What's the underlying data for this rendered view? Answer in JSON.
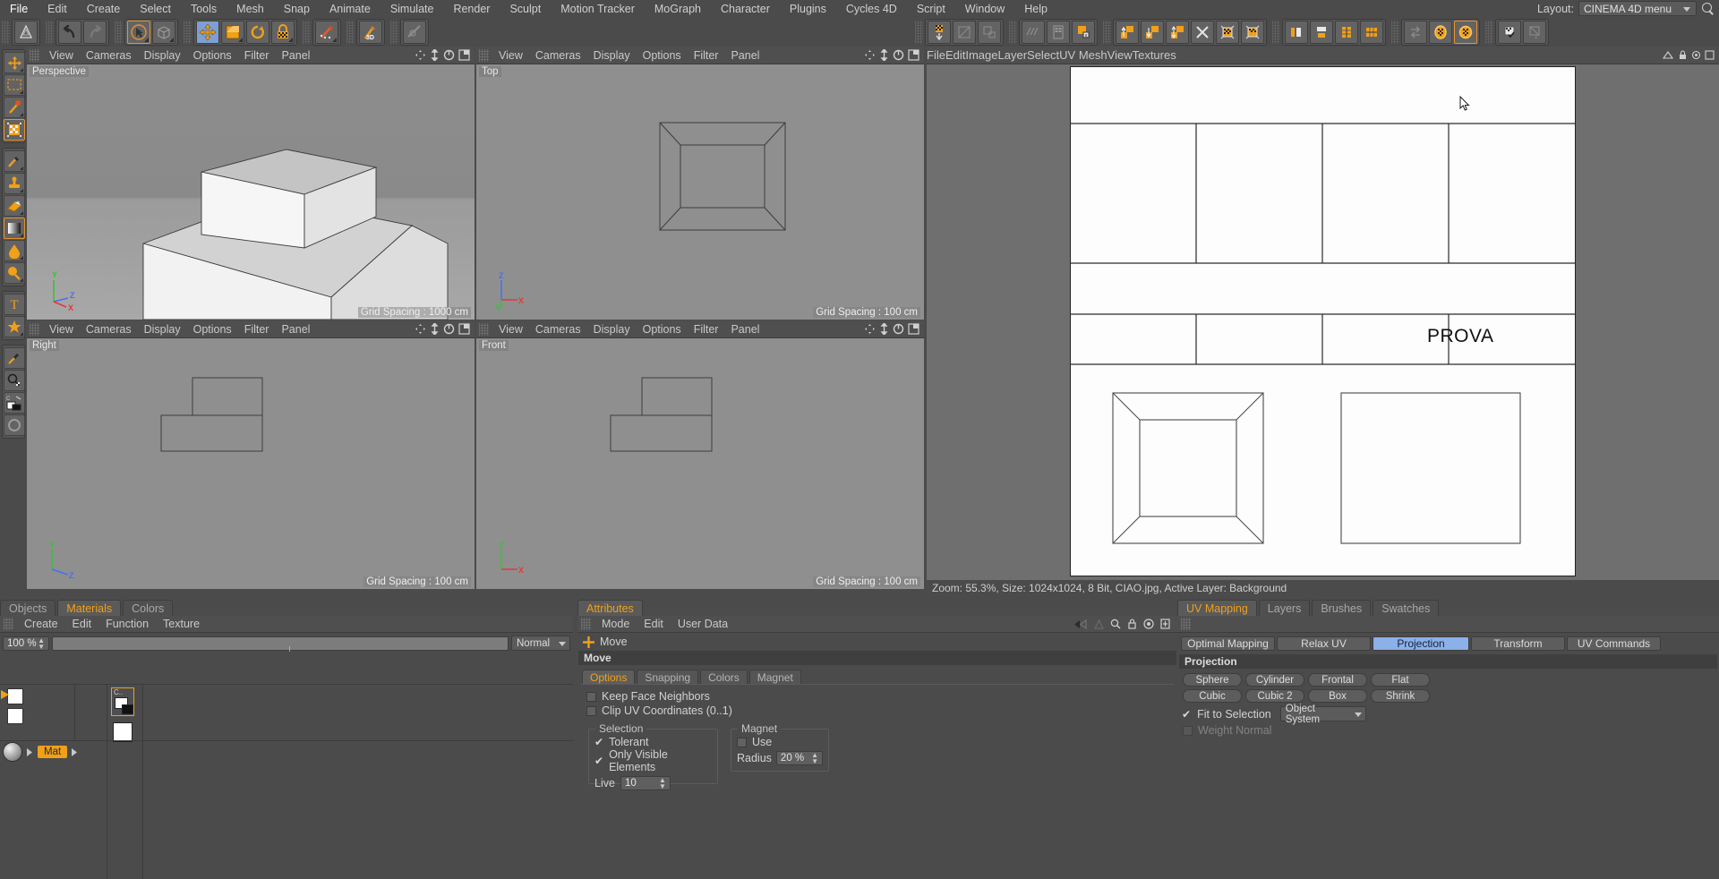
{
  "menubar": {
    "items": [
      "File",
      "Edit",
      "Create",
      "Select",
      "Tools",
      "Mesh",
      "Snap",
      "Animate",
      "Simulate",
      "Render",
      "Sculpt",
      "Motion Tracker",
      "MoGraph",
      "Character",
      "Plugins",
      "Cycles 4D",
      "Script",
      "Window",
      "Help"
    ],
    "layout_label": "Layout:",
    "layout_value": "CINEMA 4D menu",
    "search_icon": "search-icon"
  },
  "viewports": {
    "menu_items": [
      "View",
      "Cameras",
      "Display",
      "Options",
      "Filter",
      "Panel"
    ],
    "perspective": {
      "label": "Perspective",
      "grid": "Grid Spacing : 1000 cm"
    },
    "top": {
      "label": "Top",
      "grid": "Grid Spacing : 100 cm"
    },
    "right": {
      "label": "Right",
      "grid": "Grid Spacing : 100 cm"
    },
    "front": {
      "label": "Front",
      "grid": "Grid Spacing : 100 cm"
    },
    "axis_labels": [
      "X",
      "Y",
      "Z"
    ],
    "axis_colors": {
      "x": "#e03a3a",
      "y": "#35c435",
      "z": "#4a6ff0"
    }
  },
  "uv_editor": {
    "menu_items": [
      "File",
      "Edit",
      "Image",
      "Layer",
      "Select",
      "UV Mesh",
      "View",
      "Textures"
    ],
    "canvas_text": "PROVA",
    "status": "Zoom: 55.3%, Size: 1024x1024, 8 Bit, CIAO.jpg, Active Layer: Background"
  },
  "materials_panel": {
    "tabs": [
      {
        "label": "Objects",
        "active": false
      },
      {
        "label": "Materials",
        "active": true
      },
      {
        "label": "Colors",
        "active": false
      }
    ],
    "menu_items": [
      "Create",
      "Edit",
      "Function",
      "Texture"
    ],
    "zoom_value": "100 %",
    "blend_mode": "Normal",
    "material_name": "Mat",
    "swatch_label": "C.."
  },
  "attributes_panel": {
    "tabs": [
      {
        "label": "Attributes",
        "active": true
      }
    ],
    "menu_items": [
      "Mode",
      "Edit",
      "User Data"
    ],
    "breadcrumb": "Move",
    "section_title": "Move",
    "tool_icon": "move-plus-icon",
    "tabs_inner": [
      {
        "label": "Options",
        "active": true
      },
      {
        "label": "Snapping",
        "active": false
      },
      {
        "label": "Colors",
        "active": false
      },
      {
        "label": "Magnet",
        "active": false
      }
    ],
    "checkboxes": [
      {
        "label": "Keep Face Neighbors",
        "checked": false
      },
      {
        "label": "Clip UV Coordinates (0..1)",
        "checked": false
      }
    ],
    "selection_group": {
      "title": "Selection",
      "items": [
        {
          "label": "Tolerant",
          "checked": true
        },
        {
          "label": "Only Visible Elements",
          "checked": true
        }
      ],
      "live_label": "Live",
      "live_value": "10"
    },
    "magnet_group": {
      "title": "Magnet",
      "use_label": "Use",
      "use_checked": false,
      "radius_label": "Radius",
      "radius_value": "20 %"
    },
    "nav_icons": [
      "back-arrow-icon",
      "forward-arrow-icon",
      "filter-icon",
      "search-icon",
      "lock-icon",
      "target-icon",
      "pin-icon"
    ]
  },
  "uv_mapping_panel": {
    "tabs": [
      {
        "label": "UV Mapping",
        "active": true
      },
      {
        "label": "Layers",
        "active": false
      },
      {
        "label": "Brushes",
        "active": false
      },
      {
        "label": "Swatches",
        "active": false
      }
    ],
    "mode_buttons": [
      {
        "label": "Optimal Mapping",
        "active": false
      },
      {
        "label": "Relax UV",
        "active": false
      },
      {
        "label": "Projection",
        "active": true
      },
      {
        "label": "Transform",
        "active": false
      },
      {
        "label": "UV Commands",
        "active": false
      }
    ],
    "section_title": "Projection",
    "projection_buttons_row1": [
      "Sphere",
      "Cylinder",
      "Frontal",
      "Flat"
    ],
    "projection_buttons_row2": [
      "Cubic",
      "Cubic 2",
      "Box",
      "Shrink"
    ],
    "fit_to_selection": {
      "label": "Fit to Selection",
      "checked": true
    },
    "object_system": "Object System",
    "weight_normal": {
      "label": "Weight Normal",
      "checked": false,
      "disabled": true
    }
  },
  "toolbar": {
    "left_icons": [
      "logo-icon",
      "undo-icon",
      "redo-icon",
      "select-live-icon",
      "object-mode-icon",
      "move-tool-icon",
      "scale-tool-icon",
      "rotate-tool-icon",
      "snap-icon",
      "render-region-icon",
      "paint-3d-icon",
      "render-view-icon"
    ],
    "right_icons": [
      "align-icon",
      "mirror-icon",
      "axis-icon",
      "grid-icon",
      "texture-icon",
      "uv-polygon-icon",
      "move-up-icon",
      "move-down-icon",
      "move-both-icon",
      "mesh-x-icon",
      "mesh-box-icon",
      "mesh-box2-icon",
      "align-left-icon",
      "align-top-icon",
      "distribute-v-icon",
      "distribute-h-icon",
      "swap-icon",
      "uv-circle-icon",
      "uv-circle-sel-icon",
      "flag-check-icon",
      "flag-z-icon"
    ]
  },
  "left_tools": {
    "icons": [
      "move-tool-icon",
      "rect-select-icon",
      "magic-wand-icon",
      "checker-frame-icon",
      "brush-icon",
      "stamp-icon",
      "eraser-icon",
      "gradient-icon",
      "fill-icon",
      "clone-icon",
      "text-icon",
      "star-icon",
      "eyedropper-icon",
      "zoom-checker-icon",
      "color-swatch-icon",
      "circle-icon"
    ]
  },
  "colors": {
    "panel_bg": "#4b4b4b",
    "panel_light": "#5a5a5a",
    "accent_orange": "#f0a019",
    "accent_blue": "#8cb0e8",
    "viewport_bg": "#8f8f8f",
    "uv_bg": "#6f6f6f",
    "canvas_white": "#fdfdfd"
  }
}
